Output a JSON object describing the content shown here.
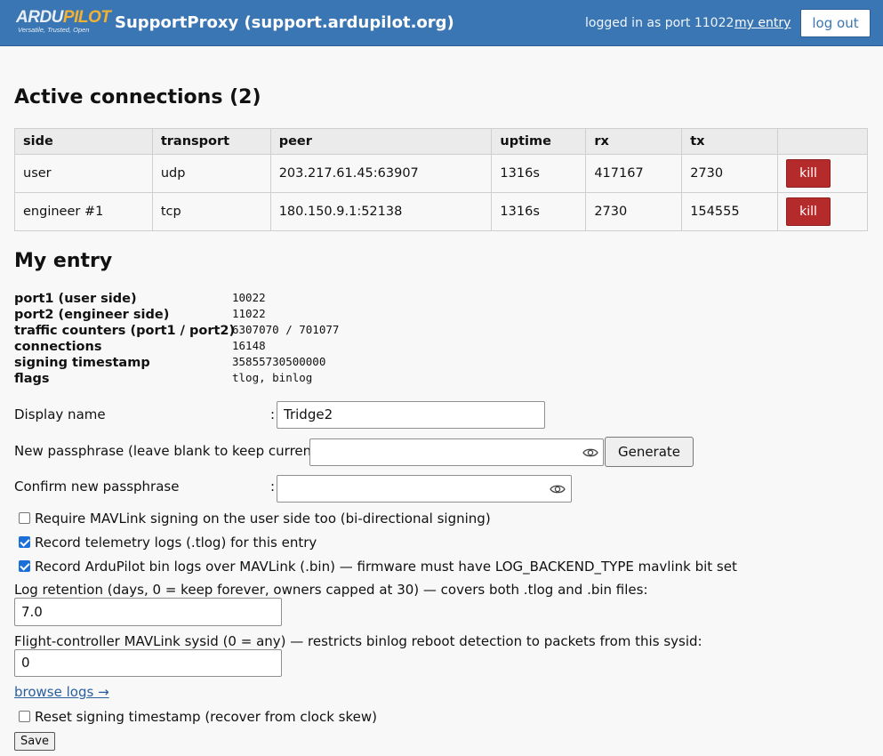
{
  "header": {
    "logo_text_a": "ARDU",
    "logo_text_b": "PILOT",
    "logo_tagline": "Versatile, Trusted, Open",
    "title": "SupportProxy (support.ardupilot.org)",
    "user_info": "logged in as port 11022",
    "my_entry_link": "my entry",
    "logout_label": "log out",
    "colors": {
      "bar": "#3a76b3",
      "logo_accent": "#f4b232"
    }
  },
  "active": {
    "heading": "Active connections (2)",
    "columns": [
      "side",
      "transport",
      "peer",
      "uptime",
      "rx",
      "tx",
      ""
    ],
    "rows": [
      {
        "side": "user",
        "transport": "udp",
        "peer": "203.217.61.45:63907",
        "uptime": "1316s",
        "rx": "417167",
        "tx": "2730",
        "action": "kill"
      },
      {
        "side": "engineer #1",
        "transport": "tcp",
        "peer": "180.150.9.1:52138",
        "uptime": "1316s",
        "rx": "2730",
        "tx": "154555",
        "action": "kill"
      }
    ],
    "kill_color": "#b52a2a"
  },
  "entry": {
    "heading": "My entry",
    "info": [
      {
        "label": "port1 (user side)",
        "value": "10022"
      },
      {
        "label": "port2 (engineer side)",
        "value": "11022"
      },
      {
        "label": "traffic counters (port1 / port2)",
        "value": "6307070 / 701077"
      },
      {
        "label": "connections",
        "value": "16148"
      },
      {
        "label": "signing timestamp",
        "value": "35855730500000"
      },
      {
        "label": "flags",
        "value": "tlog, binlog"
      }
    ]
  },
  "form": {
    "display_name_label": "Display name",
    "display_name_value": "Tridge2",
    "new_pass_label": "New passphrase (leave blank to keep current):",
    "new_pass_value": "",
    "generate_label": "Generate",
    "confirm_label": "Confirm new passphrase",
    "confirm_value": "",
    "colon": ":",
    "checkboxes": [
      {
        "label": "Require MAVLink signing on the user side too (bi-directional signing)",
        "checked": false
      },
      {
        "label": "Record telemetry logs (.tlog) for this entry",
        "checked": true
      },
      {
        "label": "Record ArduPilot bin logs over MAVLink (.bin) — firmware must have LOG_BACKEND_TYPE mavlink bit set",
        "checked": true
      }
    ],
    "retention_label": "Log retention (days, 0 = keep forever, owners capped at 30) — covers both .tlog and .bin files:",
    "retention_value": "7.0",
    "sysid_label": "Flight-controller MAVLink sysid (0 = any) — restricts binlog reboot detection to packets from this sysid:",
    "sysid_value": "0",
    "browse_logs": "browse logs →",
    "reset_label": "Reset signing timestamp (recover from clock skew)",
    "reset_checked": false,
    "save_label": "Save"
  }
}
